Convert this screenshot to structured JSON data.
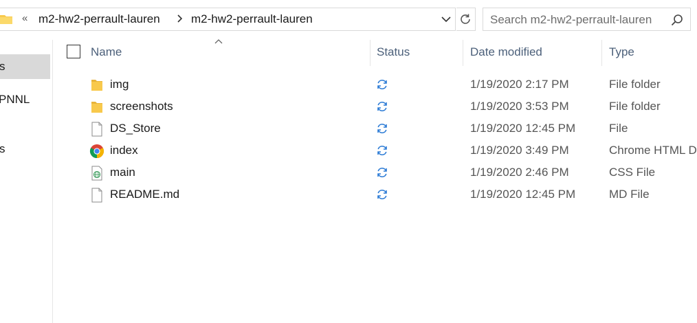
{
  "address": {
    "overflow_chevron": "«",
    "breadcrumbs": [
      "m2-hw2-perrault-lauren",
      "m2-hw2-perrault-lauren"
    ]
  },
  "search": {
    "placeholder": "Search m2-hw2-perrault-lauren"
  },
  "nav": {
    "items": [
      {
        "label": "s",
        "selected": true
      },
      {
        "label": "PNNL",
        "selected": false
      },
      {
        "label": "s",
        "selected": false
      }
    ]
  },
  "columns": {
    "name": "Name",
    "status": "Status",
    "date": "Date modified",
    "type": "Type"
  },
  "files": [
    {
      "name": "img",
      "icon": "folder-icon",
      "status": "sync-pending-icon",
      "date": "1/19/2020 2:17 PM",
      "type": "File folder"
    },
    {
      "name": "screenshots",
      "icon": "folder-icon",
      "status": "sync-pending-icon",
      "date": "1/19/2020 3:53 PM",
      "type": "File folder"
    },
    {
      "name": "DS_Store",
      "icon": "blank-file-icon",
      "status": "sync-pending-icon",
      "date": "1/19/2020 12:45 PM",
      "type": "File"
    },
    {
      "name": "index",
      "icon": "chrome-icon",
      "status": "sync-pending-icon",
      "date": "1/19/2020 3:49 PM",
      "type": "Chrome HTML D"
    },
    {
      "name": "main",
      "icon": "css-file-icon",
      "status": "sync-pending-icon",
      "date": "1/19/2020 2:46 PM",
      "type": "CSS File"
    },
    {
      "name": "README.md",
      "icon": "blank-file-icon",
      "status": "sync-pending-icon",
      "date": "1/19/2020 12:45 PM",
      "type": "MD File"
    }
  ],
  "colors": {
    "folder": "#f8c94c",
    "sync": "#2a7ad5",
    "header_text": "#4c607a",
    "nav_selected": "#d9d9d9"
  }
}
